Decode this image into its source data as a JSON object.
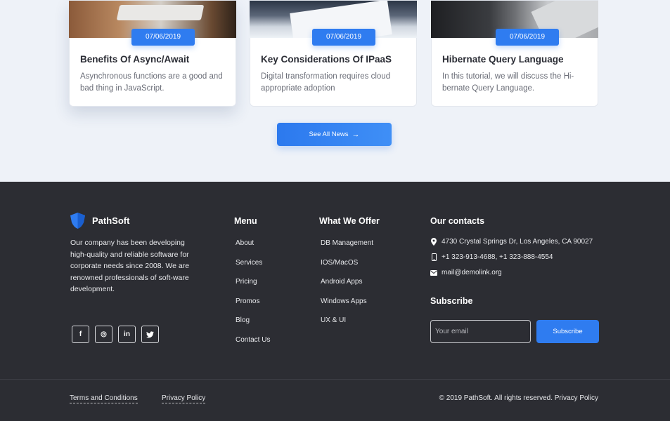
{
  "news": {
    "cards": [
      {
        "date": "07/06/2019",
        "title": "Benefits Of Async/Await",
        "excerpt": "Asynchronous functions are a good and bad thing in JavaScript."
      },
      {
        "date": "07/06/2019",
        "title": "Key Considerations Of IPaaS",
        "excerpt": "Digital transformation requires cloud appropriate adoption"
      },
      {
        "date": "07/06/2019",
        "title": "Hibernate Query Language",
        "excerpt": "In this tutorial, we will discuss the Hi-bernate Query Language."
      }
    ],
    "see_all_label": "See All News",
    "see_all_icon": "arrow-right-icon"
  },
  "footer": {
    "brand": {
      "name": "PathSoft",
      "logo_icon": "shield-logo-icon",
      "accent": "#2f7cf0"
    },
    "about": "Our company has been developing high-quality and reliable software for corporate needs since 2008. We are renowned professionals of soft-ware development.",
    "socials": [
      {
        "icon": "facebook-icon",
        "glyph": "f"
      },
      {
        "icon": "instagram-icon",
        "glyph": "◎"
      },
      {
        "icon": "linkedin-icon",
        "glyph": "in"
      },
      {
        "icon": "twitter-icon",
        "glyph": "🐦"
      }
    ],
    "menu": {
      "title": "Menu",
      "items": [
        "About",
        "Services",
        "Pricing",
        "Promos",
        "Blog",
        "Contact Us"
      ]
    },
    "offer": {
      "title": "What We Offer",
      "items": [
        "DB Management",
        "IOS/MacOS",
        "Android Apps",
        "Windows Apps",
        "UX & UI"
      ]
    },
    "contacts": {
      "title": "Our contacts",
      "address": "4730 Crystal Springs Dr, Los Angeles, CA 90027",
      "phones": "+1 323-913-4688, +1 323-888-4554",
      "email": "mail@demolink.org"
    },
    "subscribe": {
      "title": "Subscribe",
      "placeholder": "Your email",
      "button_label": "Subscribe"
    },
    "bottom": {
      "terms": "Terms and Conditions",
      "privacy": "Privacy Policy",
      "copyright": "© 2019 PathSoft. All rights reserved. Privacy Policy"
    }
  },
  "colors": {
    "primary": "#2f7cf0",
    "footer_bg": "#2c2d33",
    "page_bg": "#eef2f8"
  }
}
